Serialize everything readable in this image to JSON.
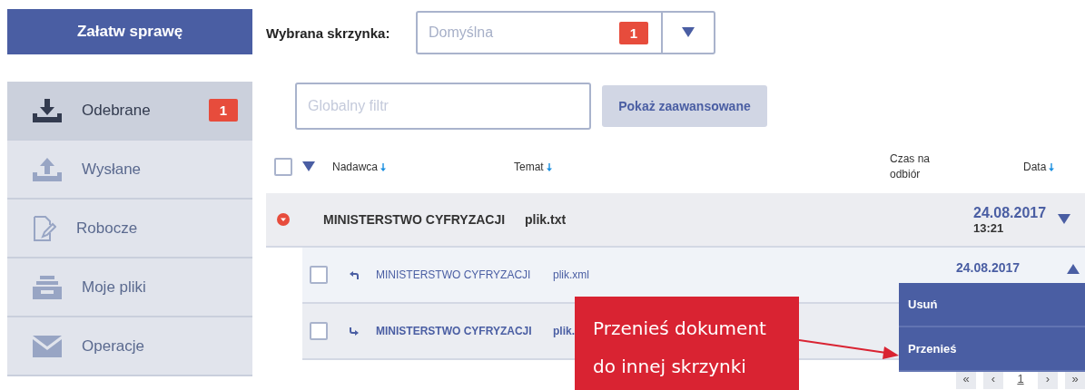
{
  "action_button": "Załatw sprawę",
  "sidebar": {
    "items": [
      {
        "label": "Odebrane",
        "selected": true,
        "badge": "1"
      },
      {
        "label": "Wysłane",
        "selected": false
      },
      {
        "label": "Robocze",
        "selected": false
      },
      {
        "label": "Moje pliki",
        "selected": false
      },
      {
        "label": "Operacje",
        "selected": false
      }
    ]
  },
  "mailbox": {
    "label": "Wybrana skrzynka:",
    "value": "Domyślna",
    "badge": "1"
  },
  "filter": {
    "placeholder": "Globalny filtr",
    "button": "Pokaż zaawansowane"
  },
  "table": {
    "select_all_checked": false,
    "columns": [
      "Nadawca",
      "Temat",
      "Czas na odbiór",
      "Data"
    ],
    "group": {
      "sender": "MINISTERSTWO CYFRYZACJI",
      "subject": "plik.txt",
      "date": "24.08.2017",
      "time": "13:21",
      "expanded": true
    },
    "rows": [
      {
        "kind": "reply",
        "sender": "MINISTERSTWO CYFRYZACJI",
        "subject": "plik.xml",
        "date": "24.08.2017",
        "checked": false,
        "unread": false,
        "menu_open": true
      },
      {
        "kind": "forward",
        "sender": "MINISTERSTWO CYFRYZACJI",
        "subject": "plik.",
        "checked": false,
        "unread": true,
        "menu_open": false
      }
    ]
  },
  "row_menu": [
    "Usuń",
    "Przenieś"
  ],
  "pagination": [
    "«",
    "‹",
    "1",
    "›",
    "»"
  ],
  "callout": {
    "lines": [
      "Przenieś dokument",
      "do innej skrzynki"
    ]
  }
}
